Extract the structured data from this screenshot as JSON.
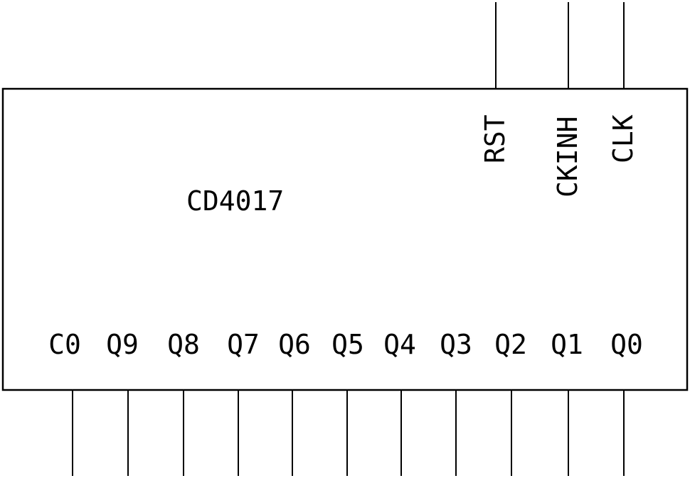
{
  "component": {
    "name": "CD4017",
    "border_color": "#000000",
    "background": "#ffffff"
  },
  "top_pins": [
    {
      "label": "RST"
    },
    {
      "label": "CKINH"
    },
    {
      "label": "CLK"
    }
  ],
  "bottom_pins": [
    {
      "label": "C0"
    },
    {
      "label": "Q9"
    },
    {
      "label": "Q8"
    },
    {
      "label": "Q7"
    },
    {
      "label": "Q6"
    },
    {
      "label": "Q5"
    },
    {
      "label": "Q4"
    },
    {
      "label": "Q3"
    },
    {
      "label": "Q2"
    },
    {
      "label": "Q1"
    },
    {
      "label": "Q0"
    }
  ]
}
